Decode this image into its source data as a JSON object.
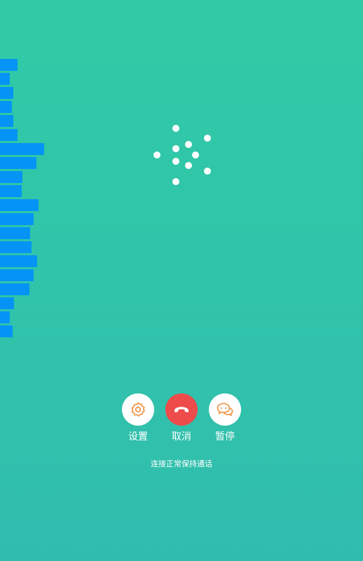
{
  "volume_meter": {
    "levels": [
      25,
      14,
      19,
      17,
      19,
      25,
      63,
      52,
      32,
      31,
      55,
      48,
      43,
      45,
      53,
      48,
      42,
      20,
      14,
      18
    ]
  },
  "controls": {
    "settings": {
      "label": "设置",
      "icon": "gear-icon",
      "icon_color": "#f0994f"
    },
    "cancel": {
      "label": "取消",
      "icon": "phone-hangup-icon",
      "bg_color": "#ee4b4b"
    },
    "pause": {
      "label": "暂停",
      "icon": "chat-bubbles-icon",
      "icon_color": "#f0994f"
    }
  },
  "status_text": "连接正常保持通话",
  "colors": {
    "bg_top": "#30cba6",
    "bg_bottom": "#31bdae",
    "meter": "#0594f5",
    "accent": "#f0994f",
    "hangup": "#ee4b4b"
  }
}
